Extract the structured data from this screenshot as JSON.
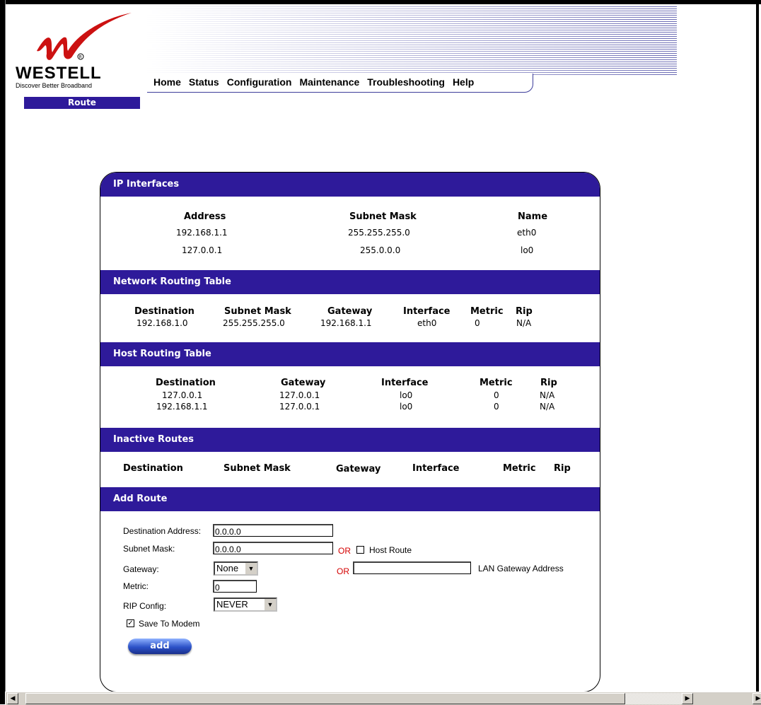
{
  "logo": {
    "brand": "WESTELL",
    "tagline": "Discover Better Broadband"
  },
  "nav": {
    "items": [
      "Home",
      "Status",
      "Configuration",
      "Maintenance",
      "Troubleshooting",
      "Help"
    ]
  },
  "page_badge": "Route",
  "ip_interfaces": {
    "title": "IP Interfaces",
    "headers": [
      "Address",
      "Subnet Mask",
      "Name"
    ],
    "rows": [
      [
        "192.168.1.1",
        "255.255.255.0",
        "eth0"
      ],
      [
        "127.0.0.1",
        "255.0.0.0",
        "lo0"
      ]
    ]
  },
  "network_routing": {
    "title": "Network Routing Table",
    "headers": [
      "Destination",
      "Subnet Mask",
      "Gateway",
      "Interface",
      "Metric",
      "Rip"
    ],
    "rows": [
      [
        "192.168.1.0",
        "255.255.255.0",
        "192.168.1.1",
        "eth0",
        "0",
        "N/A"
      ]
    ]
  },
  "host_routing": {
    "title": "Host Routing Table",
    "headers": [
      "Destination",
      "Gateway",
      "Interface",
      "Metric",
      "Rip"
    ],
    "rows": [
      [
        "127.0.0.1",
        "127.0.0.1",
        "lo0",
        "0",
        "N/A"
      ],
      [
        "192.168.1.1",
        "127.0.0.1",
        "lo0",
        "0",
        "N/A"
      ]
    ]
  },
  "inactive_routes": {
    "title": "Inactive Routes",
    "headers": [
      "Destination",
      "Subnet Mask",
      "Gateway",
      "Interface",
      "Metric",
      "Rip"
    ]
  },
  "add_route": {
    "title": "Add Route",
    "destination_label": "Destination Address:",
    "destination_value": "0.0.0.0",
    "subnet_label": "Subnet Mask:",
    "subnet_value": "0.0.0.0",
    "or_text": "OR",
    "host_route_label": "Host Route",
    "host_route_checked": false,
    "gateway_label": "Gateway:",
    "gateway_selected": "None",
    "lan_gateway_value": "",
    "lan_gateway_label": "LAN Gateway Address",
    "metric_label": "Metric:",
    "metric_value": "0",
    "rip_label": "RIP Config:",
    "rip_selected": "NEVER",
    "save_label": "Save To Modem",
    "save_checked": true,
    "add_button": "add"
  },
  "colors": {
    "accent": "#2e1a9a",
    "or_red": "#d40000"
  }
}
